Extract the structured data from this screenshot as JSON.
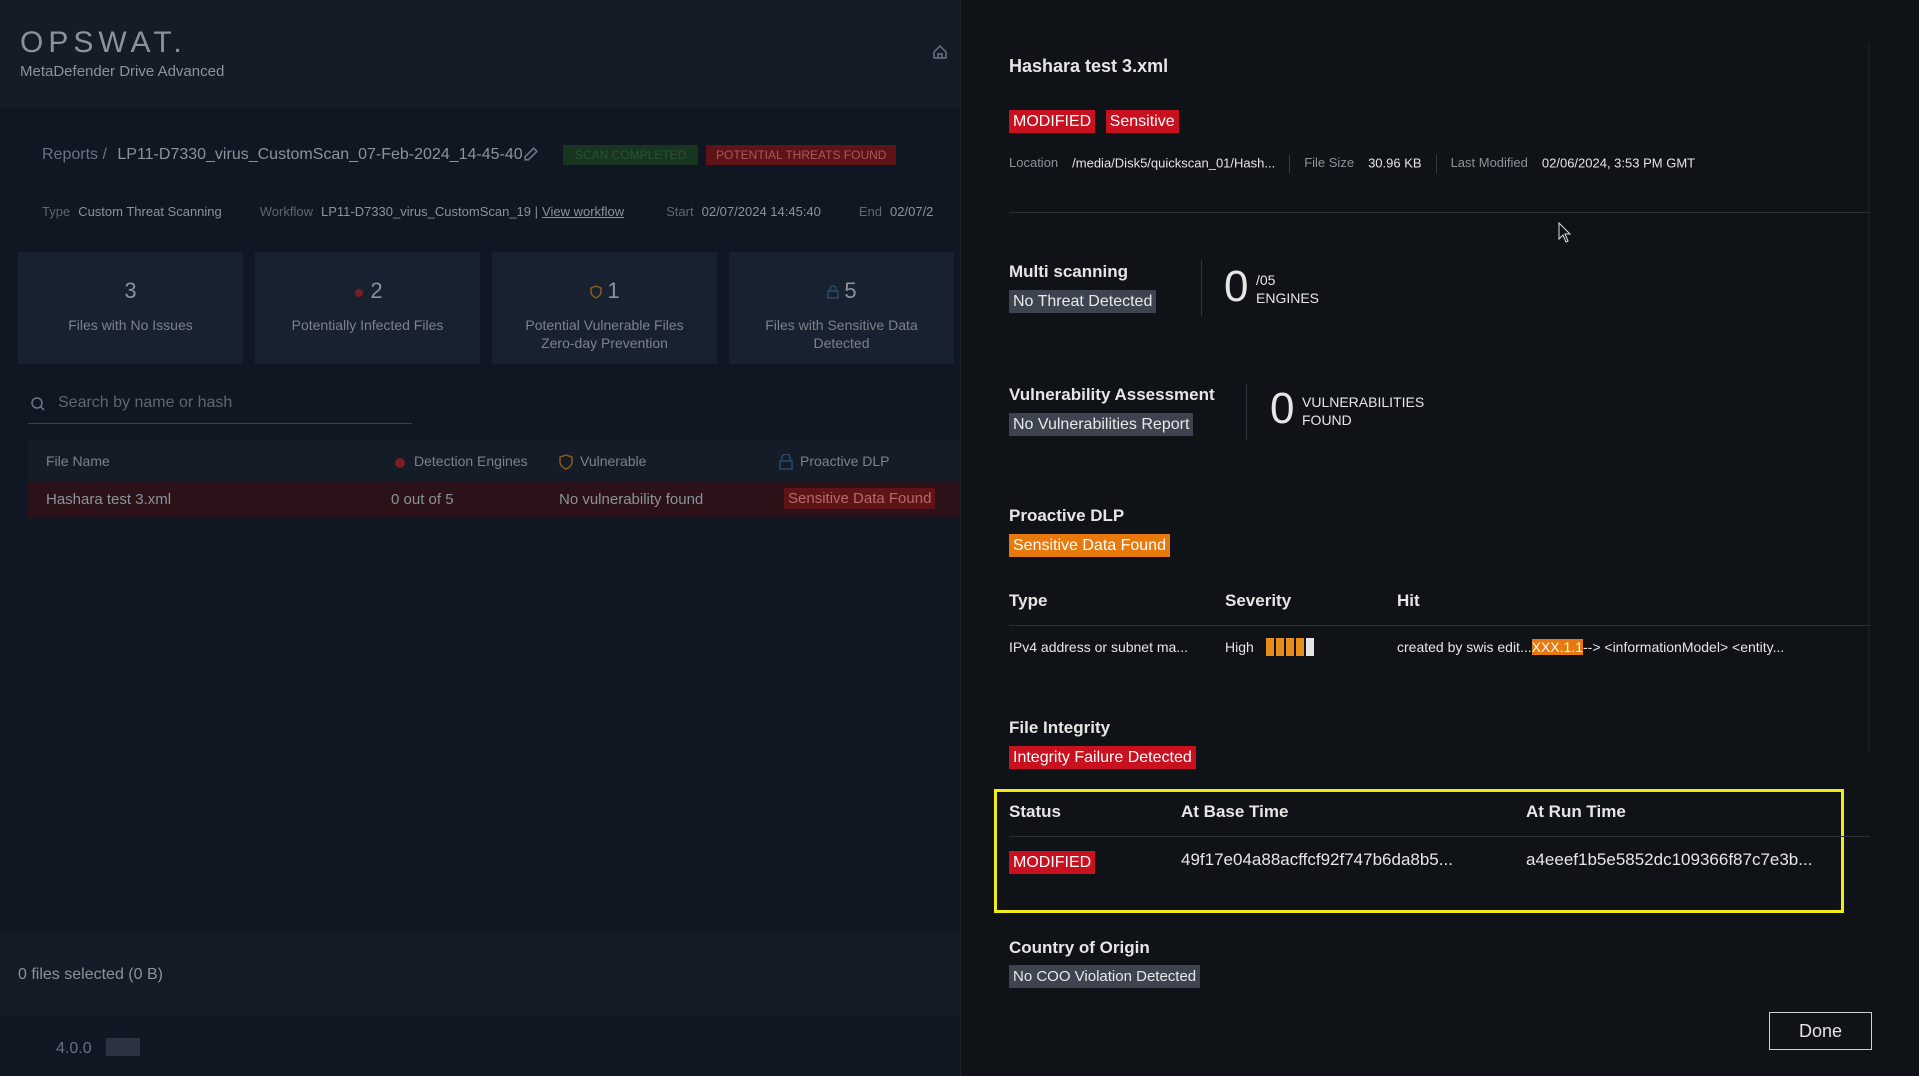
{
  "app": {
    "logo": "OPSWAT.",
    "subtitle": "MetaDefender Drive Advanced"
  },
  "report": {
    "breadcrumb_root": "Reports /",
    "name": "LP11-D7330_virus_CustomScan_07-Feb-2024_14-45-40",
    "status_badge": "SCAN COMPLETED",
    "threat_badge": "POTENTIAL THREATS FOUND",
    "type_label": "Type",
    "type_value": "Custom Threat Scanning",
    "workflow_label": "Workflow",
    "workflow_value": "LP11-D7330_virus_CustomScan_19 |",
    "workflow_link": "View workflow",
    "start_label": "Start",
    "start_value": "02/07/2024 14:45:40",
    "end_label": "End",
    "end_value": "02/07/2"
  },
  "cards": [
    {
      "count": "3",
      "label": "Files with No Issues",
      "icon": "none"
    },
    {
      "count": "2",
      "label": "Potentially Infected Files",
      "icon": "bug-icon"
    },
    {
      "count": "1",
      "label": "Potential Vulnerable Files Zero-day Prevention",
      "icon": "shield-icon"
    },
    {
      "count": "5",
      "label": "Files with Sensitive Data Detected",
      "icon": "lock-icon"
    }
  ],
  "search": {
    "placeholder": "Search by name or hash"
  },
  "table": {
    "headers": [
      "File Name",
      "Detection Engines",
      "Vulnerable",
      "Proactive DLP"
    ],
    "rows": [
      {
        "file": "Hashara test 3.xml",
        "engines": "0 out of 5",
        "vulnerable": "No vulnerability found",
        "dlp": "Sensitive Data Found"
      }
    ]
  },
  "footer": {
    "selected": "0 files selected (0 B)",
    "version": "4.0.0"
  },
  "drawer": {
    "title": "Hashara test 3.xml",
    "badges": [
      "MODIFIED",
      "Sensitive"
    ],
    "location_label": "Location",
    "location_value": "/media/Disk5/quickscan_01/Hash...",
    "size_label": "File Size",
    "size_value": "30.96 KB",
    "modified_label": "Last Modified",
    "modified_value": "02/06/2024, 3:53 PM GMT",
    "multiscan": {
      "title": "Multi scanning",
      "status": "No Threat Detected",
      "count": "0",
      "total": "/05",
      "unit": "ENGINES"
    },
    "vuln": {
      "title": "Vulnerability Assessment",
      "status": "No Vulnerabilities Report",
      "count": "0",
      "unit_line1": "VULNERABILITIES",
      "unit_line2": "FOUND"
    },
    "dlp": {
      "title": "Proactive DLP",
      "status": "Sensitive Data Found",
      "col_type": "Type",
      "col_severity": "Severity",
      "col_hit": "Hit",
      "type_value": "IPv4 address or subnet ma...",
      "severity_value": "High",
      "severity_level": 4,
      "severity_max": 5,
      "hit_before": "created by swis edit...",
      "hit_match": "XXX.1.1",
      "hit_after": "--> <informationModel> <entity..."
    },
    "integrity": {
      "title": "File Integrity",
      "status": "Integrity Failure Detected",
      "col_status": "Status",
      "col_base": "At Base Time",
      "col_run": "At Run Time",
      "row_status": "MODIFIED",
      "base_hash": "49f17e04a88acffcf92f747b6da8b5...",
      "run_hash": "a4eeef1b5e5852dc109366f87c7e3b..."
    },
    "coo": {
      "title": "Country of Origin",
      "status": "No COO Violation Detected"
    },
    "done": "Done"
  },
  "colors": {
    "accent_red": "#c8101e",
    "accent_orange": "#e8790c",
    "highlight_yellow": "#f2eb19"
  }
}
